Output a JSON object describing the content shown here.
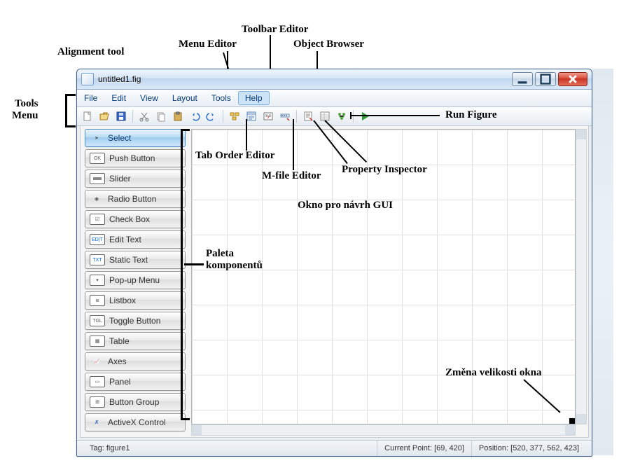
{
  "annotations": {
    "tools_menu": "Tools\nMenu",
    "alignment_tool": "Alignment tool",
    "menu_editor": "Menu Editor",
    "toolbar_editor": "Toolbar Editor",
    "object_browser": "Object Browser",
    "tab_order_editor": "Tab Order Editor",
    "mfile_editor": "M-file Editor",
    "property_inspector": "Property Inspector",
    "run_figure": "Run Figure",
    "palette_label": "Paleta\nkomponentů",
    "canvas_label": "Okno pro návrh GUI",
    "resize_label": "Změna velikosti okna"
  },
  "window": {
    "title": "untitled1.fig"
  },
  "menu": {
    "items": [
      "File",
      "Edit",
      "View",
      "Layout",
      "Tools",
      "Help"
    ],
    "hover_index": 5
  },
  "toolbar": {
    "icons": [
      "new",
      "open",
      "save",
      "cut",
      "copy",
      "paste",
      "undo",
      "redo",
      "align",
      "menu-editor",
      "tab-order",
      "toolbar-editor",
      "mfile-editor",
      "property-inspector",
      "object-browser",
      "run"
    ]
  },
  "palette": {
    "items": [
      {
        "icon": "cursor",
        "label": "Select",
        "selected": true
      },
      {
        "icon": "ok",
        "label": "Push Button"
      },
      {
        "icon": "slider",
        "label": "Slider"
      },
      {
        "icon": "radio",
        "label": "Radio Button"
      },
      {
        "icon": "check",
        "label": "Check Box"
      },
      {
        "icon": "edit",
        "label": "Edit Text"
      },
      {
        "icon": "txt",
        "label": "Static Text"
      },
      {
        "icon": "popup",
        "label": "Pop-up Menu"
      },
      {
        "icon": "list",
        "label": "Listbox"
      },
      {
        "icon": "toggle",
        "label": "Toggle Button"
      },
      {
        "icon": "table",
        "label": "Table"
      },
      {
        "icon": "axes",
        "label": "Axes"
      },
      {
        "icon": "panel",
        "label": "Panel"
      },
      {
        "icon": "group",
        "label": "Button Group"
      },
      {
        "icon": "activex",
        "label": "ActiveX Control"
      }
    ]
  },
  "status": {
    "tag": "Tag: figure1",
    "current_point": "Current Point:  [69, 420]",
    "position": "Position: [520, 377, 562, 423]"
  }
}
